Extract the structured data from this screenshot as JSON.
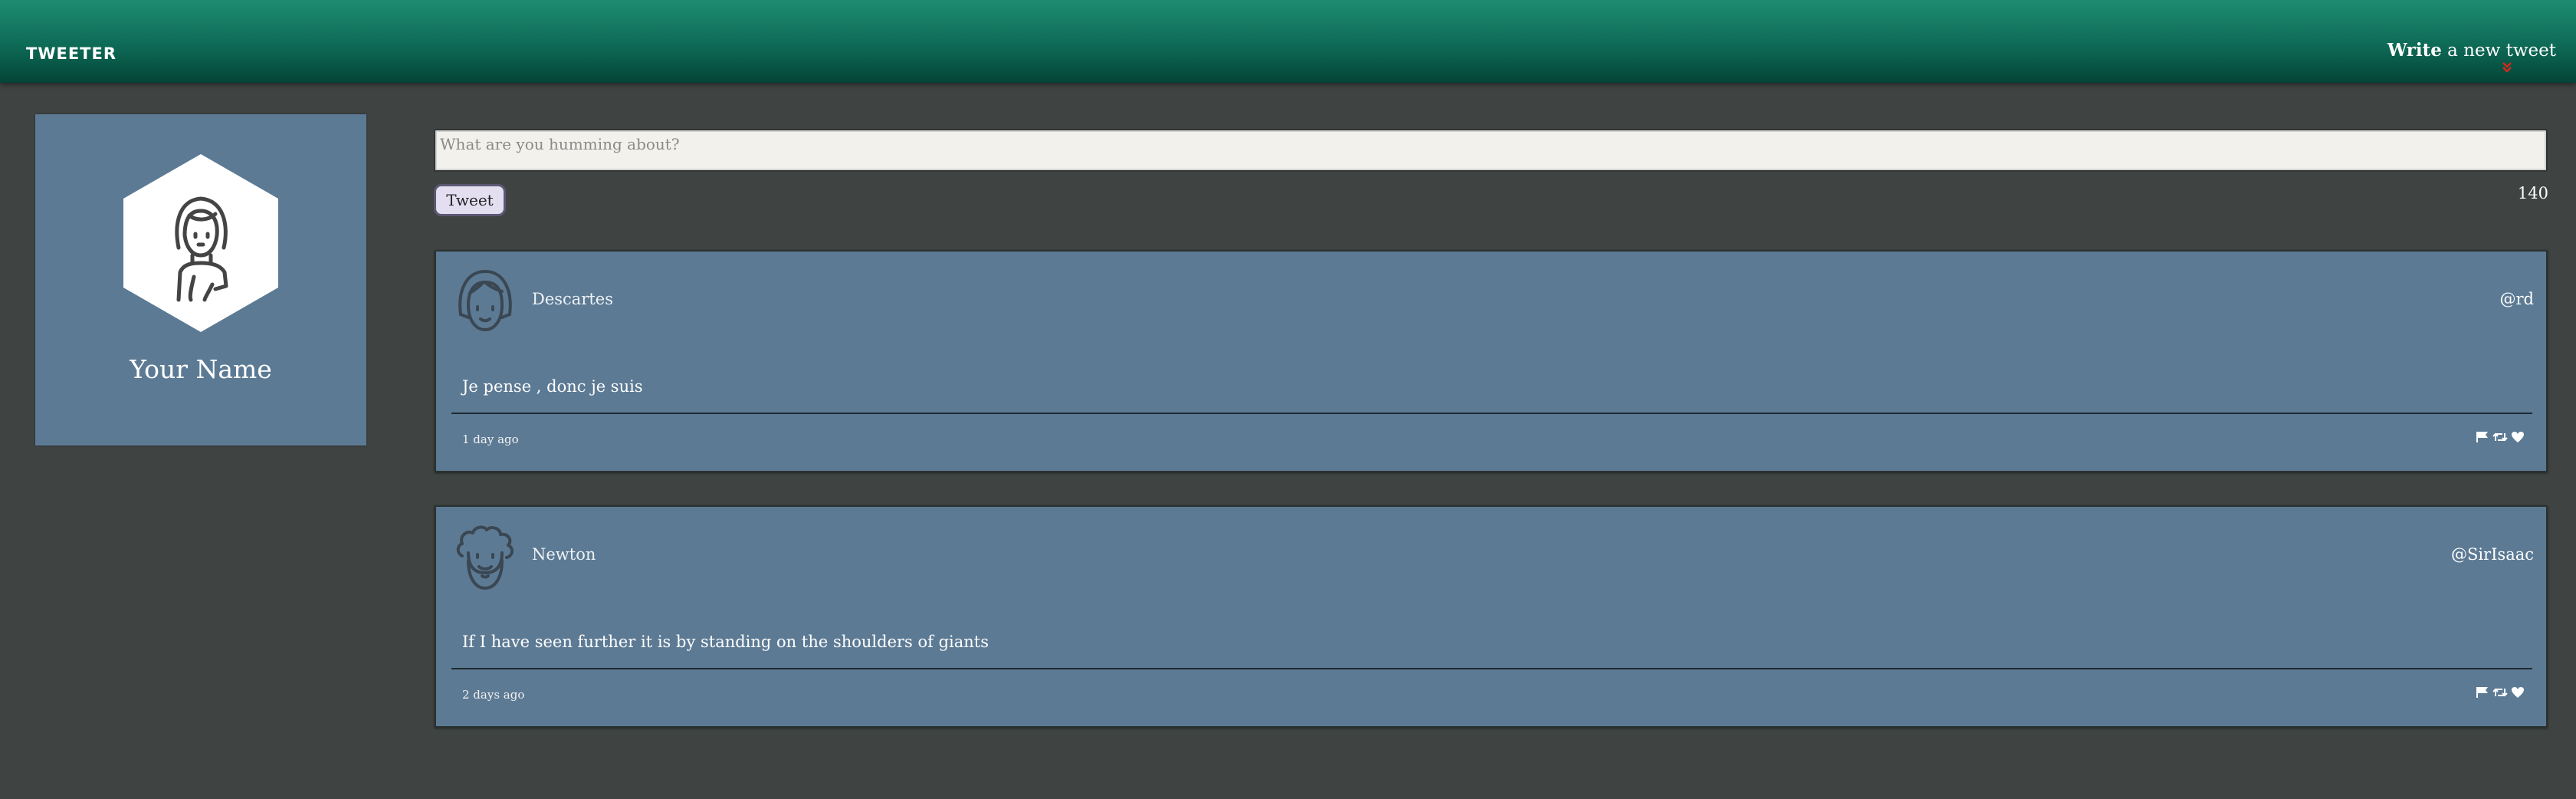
{
  "header": {
    "brand": "TWEETER",
    "compose_strong": "Write",
    "compose_rest": " a new tweet",
    "chevron_icon": "double-chevron-down-icon",
    "chevron_color": "#d9261c"
  },
  "profile": {
    "name": "Your Name",
    "avatar_icon": "woman-avatar-icon"
  },
  "composer": {
    "placeholder": "What are you humming about?",
    "button_label": "Tweet",
    "counter": "140"
  },
  "tweets": [
    {
      "author": "Descartes",
      "handle": "@rd",
      "content": "Je pense , donc je suis",
      "time": "1 day ago",
      "avatar_icon": "bob-haircut-avatar-icon"
    },
    {
      "author": "Newton",
      "handle": "@SirIsaac",
      "content": "If I have seen further it is by standing on the shoulders of giants",
      "time": "2 days ago",
      "avatar_icon": "curly-hair-bearded-avatar-icon"
    }
  ],
  "tweet_actions": [
    "flag-icon",
    "retweet-icon",
    "heart-icon"
  ],
  "colors": {
    "header_top": "#1f8c72",
    "header_bottom": "#044437",
    "background": "#3f4443",
    "card": "#5c7a94"
  }
}
